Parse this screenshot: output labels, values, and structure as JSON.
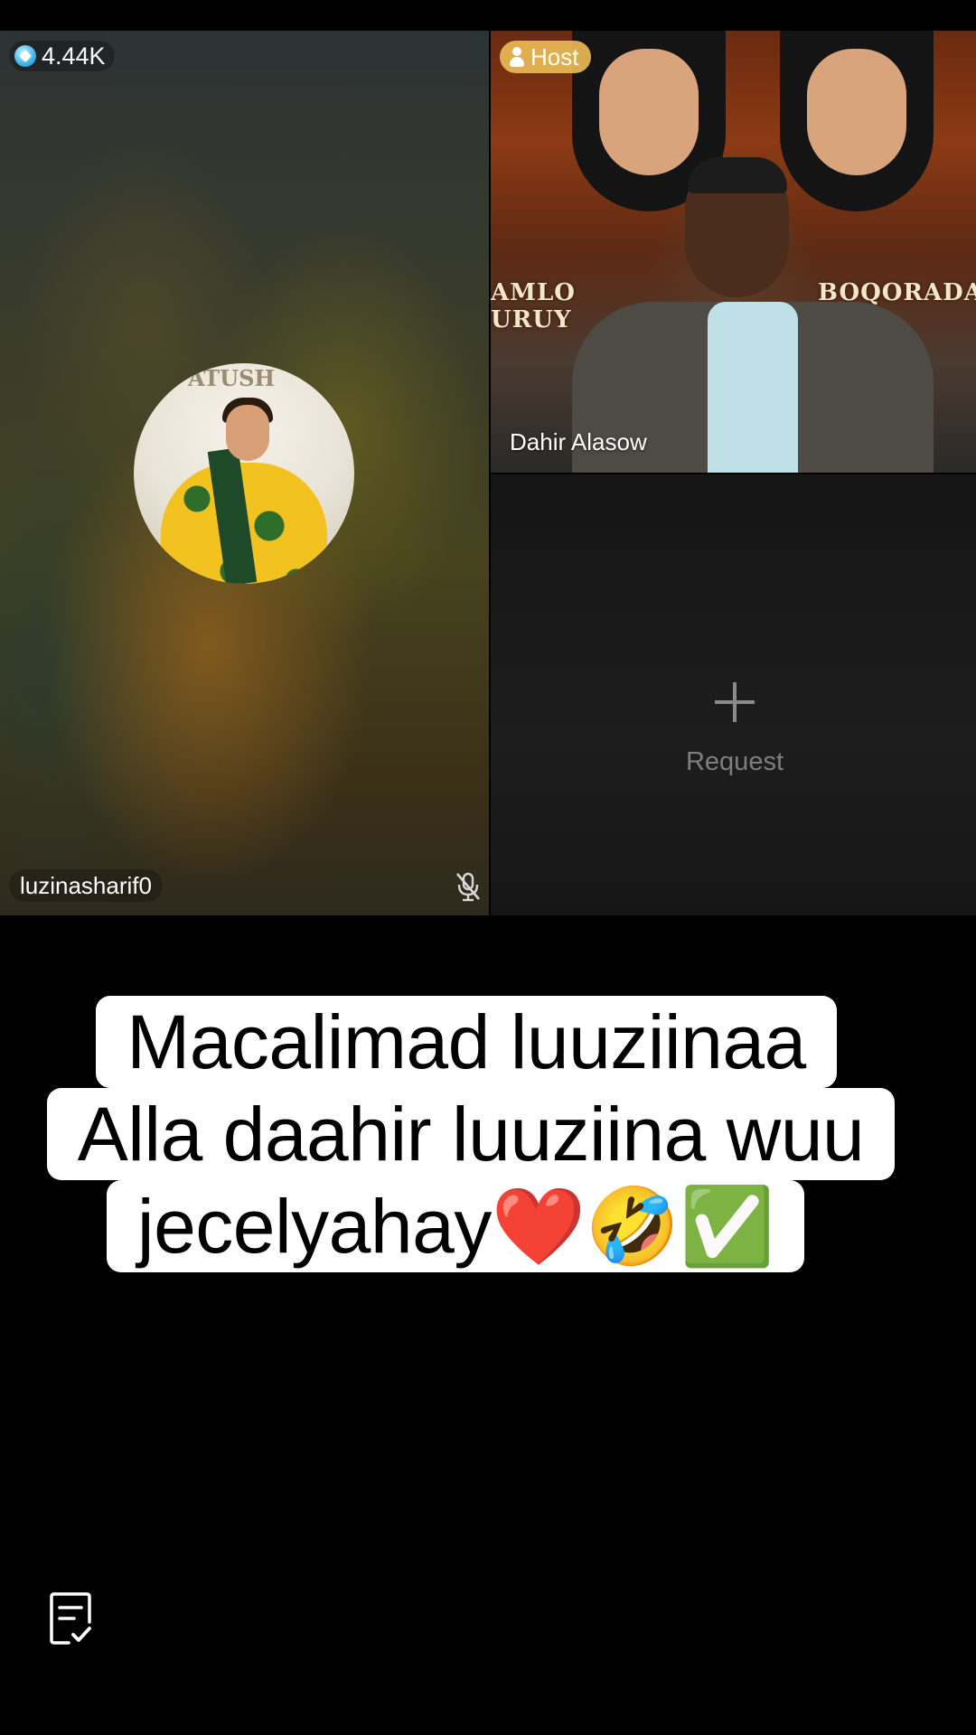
{
  "live": {
    "viewer_count": "4.44K",
    "host": {
      "badge_label": "Host",
      "name": "Dahir Alasow",
      "banner_left": "AMLO\nURUY",
      "banner_right": "BOQORADA\nELKA"
    },
    "guest": {
      "username": "luzinasharif0",
      "mic_muted": true,
      "avatar_sign_text": "ATUSH"
    },
    "request_slot": {
      "label": "Request"
    }
  },
  "caption": {
    "line1": "Macalimad luuziinaa",
    "line2": "Alla daahir luuziina wuu",
    "line3": "jecelyahay❤️🤣✅"
  },
  "colors": {
    "host_badge": "#e9ba54",
    "gem": "#3fb4e8",
    "request_text": "#7e7e7e"
  }
}
